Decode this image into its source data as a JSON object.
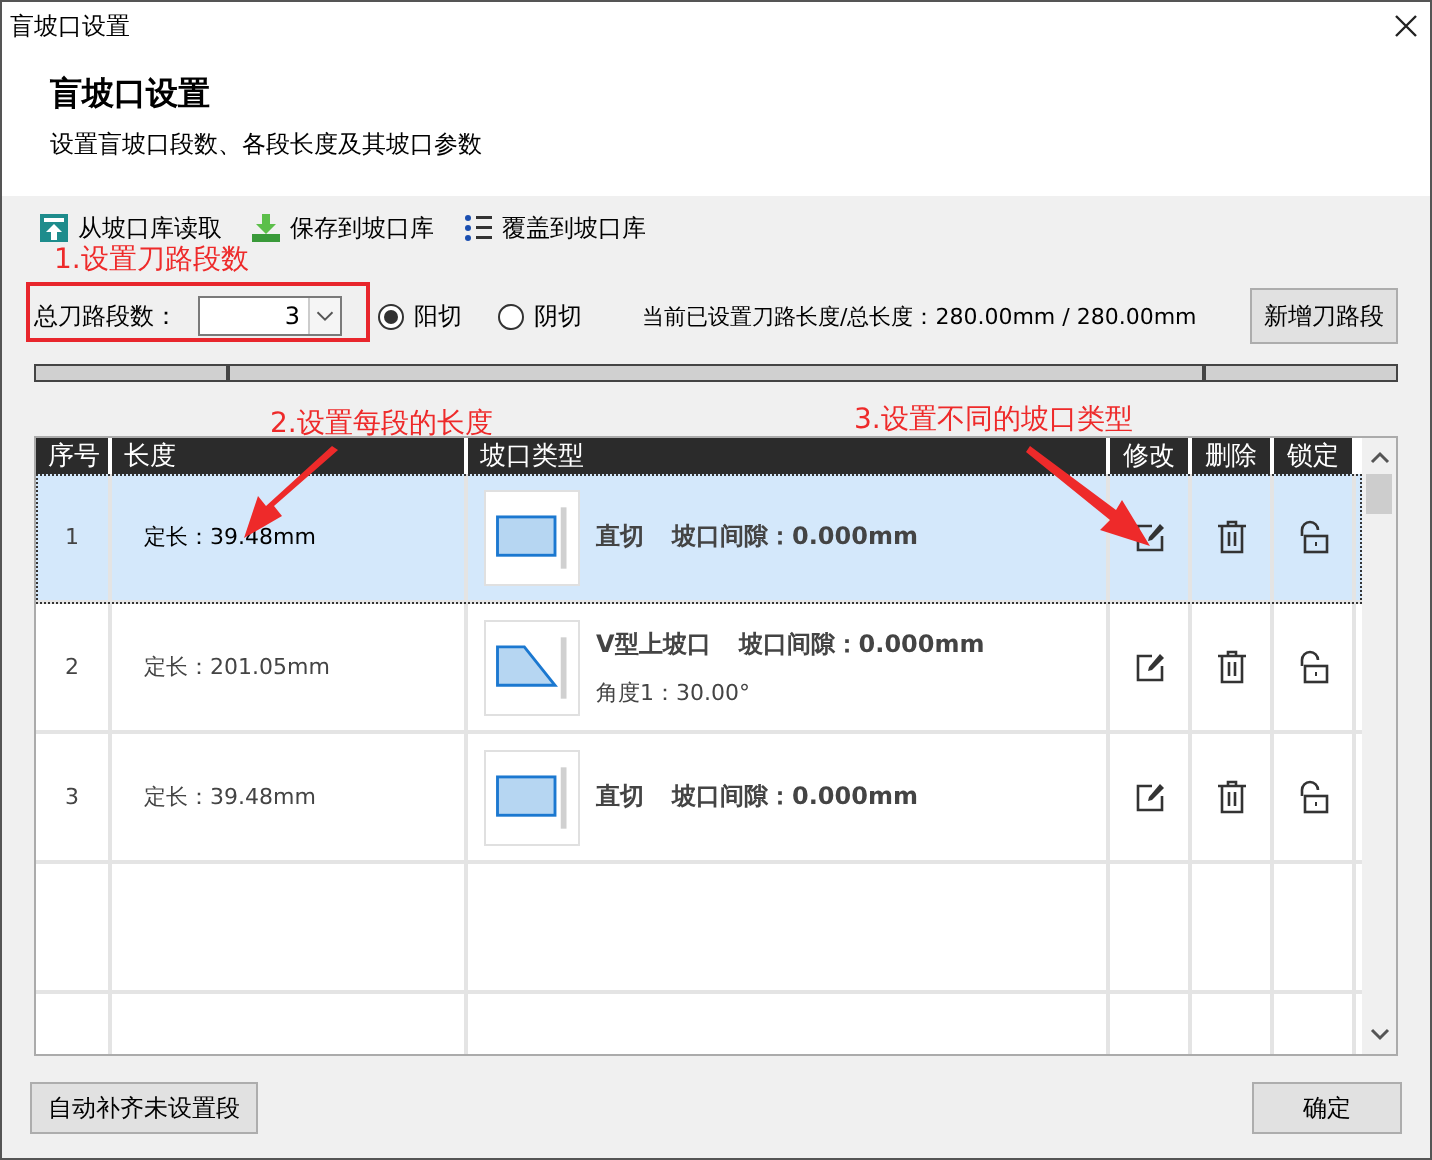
{
  "window": {
    "title": "盲坡口设置"
  },
  "header": {
    "title": "盲坡口设置",
    "subtitle": "设置盲坡口段数、各段长度及其坡口参数"
  },
  "toolbar": [
    {
      "kind": "load",
      "label": "从坡口库读取"
    },
    {
      "kind": "save",
      "label": "保存到坡口库"
    },
    {
      "kind": "overwrite",
      "label": "覆盖到坡口库"
    }
  ],
  "segment_count": {
    "label": "总刀路段数：",
    "value": "3"
  },
  "cut_modes": [
    {
      "label": "阳切",
      "selected": true
    },
    {
      "label": "阴切",
      "selected": false
    }
  ],
  "length_summary": "当前已设置刀路长度/总长度：280.00mm / 280.00mm",
  "add_button": "新增刀路段",
  "table": {
    "columns": [
      "序号",
      "长度",
      "坡口类型",
      "修改",
      "删除",
      "锁定"
    ],
    "rows": [
      {
        "index": "1",
        "length": "定长：39.48mm",
        "kind": "straight",
        "type": "直切",
        "gap": "坡口间隙：0.000mm",
        "selected": true,
        "locked": false
      },
      {
        "index": "2",
        "length": "定长：201.05mm",
        "kind": "v_top",
        "type": "V型上坡口",
        "gap": "坡口间隙：0.000mm",
        "angle": "角度1：30.00°",
        "selected": false,
        "locked": false
      },
      {
        "index": "3",
        "length": "定长：39.48mm",
        "kind": "straight",
        "type": "直切",
        "gap": "坡口间隙：0.000mm",
        "selected": false,
        "locked": false
      }
    ]
  },
  "annotations": [
    {
      "text": "1.设置刀路段数"
    },
    {
      "text": "2.设置每段的长度"
    },
    {
      "text": "3.设置不同的坡口类型"
    }
  ],
  "footer": {
    "auto_fill_button": "自动补齐未设置段",
    "ok_button": "确定"
  }
}
